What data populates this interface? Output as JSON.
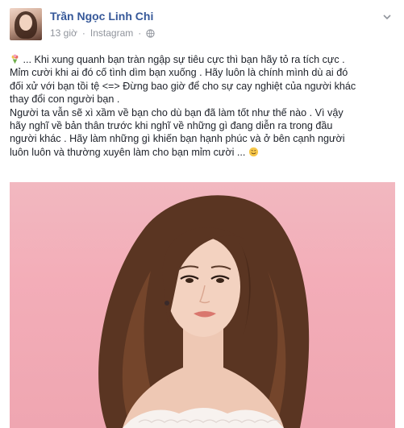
{
  "post": {
    "author": "Trần Ngọc Linh Chi",
    "time": "13 giờ",
    "source": "Instagram",
    "lines": [
      "... Khi xung quanh bạn tràn ngập sự tiêu cực thì bạn hãy tỏ ra tích cực .",
      "Mỉm cười khi ai đó cố tình dìm bạn xuống . Hãy luôn là chính mình dù ai đó",
      "đối xử với bạn tồi tệ <=> Đừng bao giờ để cho sự cay nghiệt của người khác",
      "thay đổi con người bạn .",
      "Người ta vẫn sẽ xì xầm về bạn cho dù bạn đã làm tốt như thế nào . Vì vậy",
      "hãy nghĩ về bản thân trước khi nghĩ về những gì đang diễn ra trong đầu",
      "người khác . Hãy làm những gì khiến bạn hạnh phúc và ở bên cạnh người",
      "luôn luôn và thường xuyên làm cho bạn mỉm cười ..."
    ]
  },
  "icons": {
    "globe": "globe-icon",
    "chevron": "chevron-down-icon",
    "bouquet": "bouquet-emoji-icon",
    "smile": "smiling-emoji-icon"
  },
  "colors": {
    "author_link": "#365899",
    "meta_text": "#90949c",
    "photo_background": "#f3adb8"
  }
}
